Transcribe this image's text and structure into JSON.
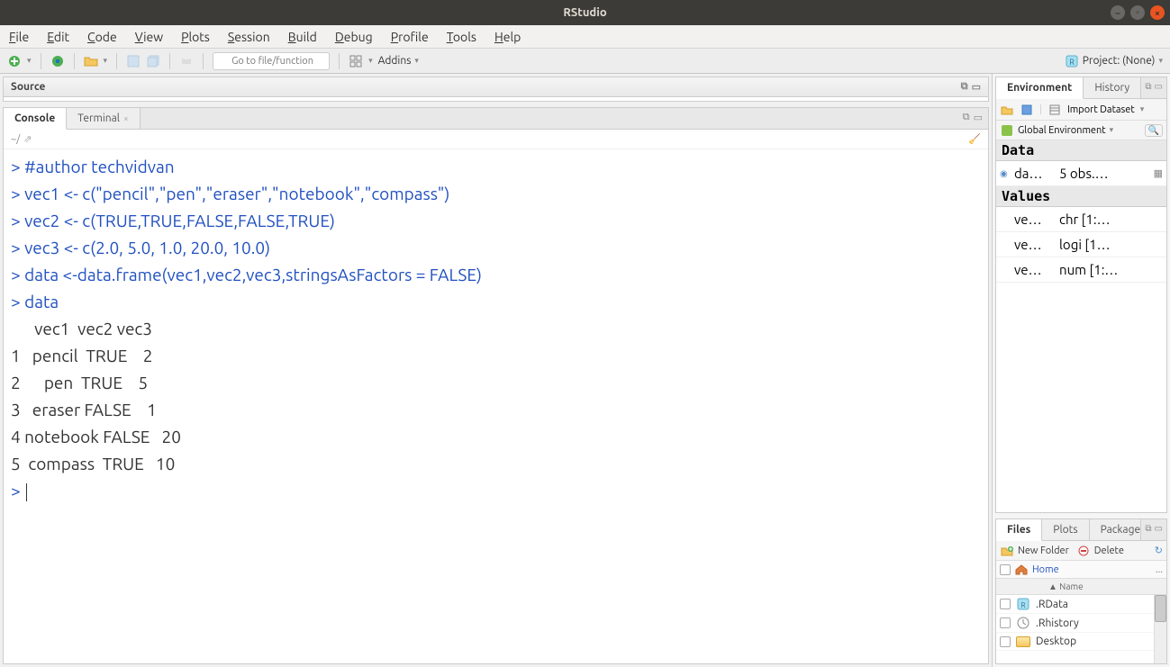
{
  "window": {
    "title": "RStudio"
  },
  "menubar": [
    "File",
    "Edit",
    "Code",
    "View",
    "Plots",
    "Session",
    "Build",
    "Debug",
    "Profile",
    "Tools",
    "Help"
  ],
  "toolbar": {
    "goto_placeholder": "Go to file/function",
    "addins": "Addins",
    "project": "Project: (None)"
  },
  "source": {
    "title": "Source"
  },
  "console": {
    "tabs": [
      {
        "label": "Console",
        "active": true
      },
      {
        "label": "Terminal",
        "active": false,
        "closable": true
      }
    ],
    "path": "~/",
    "prompt": ">",
    "lines": [
      {
        "type": "in",
        "text": "#author techvidvan"
      },
      {
        "type": "in",
        "text": "vec1 <- c(\"pencil\",\"pen\",\"eraser\",\"notebook\",\"compass\")"
      },
      {
        "type": "in",
        "text": "vec2 <- c(TRUE,TRUE,FALSE,FALSE,TRUE)"
      },
      {
        "type": "in",
        "text": "vec3 <- c(2.0, 5.0, 1.0, 20.0, 10.0)"
      },
      {
        "type": "in",
        "text": "data <-data.frame(vec1,vec2,vec3,stringsAsFactors = FALSE)"
      },
      {
        "type": "in",
        "text": "data"
      },
      {
        "type": "out",
        "text": "      vec1  vec2 vec3"
      },
      {
        "type": "out",
        "text": "1   pencil  TRUE    2"
      },
      {
        "type": "out",
        "text": "2      pen  TRUE    5"
      },
      {
        "type": "out",
        "text": "3   eraser FALSE    1"
      },
      {
        "type": "out",
        "text": "4 notebook FALSE   20"
      },
      {
        "type": "out",
        "text": "5  compass  TRUE   10"
      }
    ]
  },
  "env": {
    "tabs": [
      "Environment",
      "History"
    ],
    "import": "Import Dataset",
    "scope": "Global Environment",
    "sections": [
      {
        "title": "Data",
        "rows": [
          {
            "name": "da…",
            "val": "5 obs.…",
            "icon": "table"
          }
        ]
      },
      {
        "title": "Values",
        "rows": [
          {
            "name": "ve…",
            "val": "chr [1:…"
          },
          {
            "name": "ve…",
            "val": "logi [1…"
          },
          {
            "name": "ve…",
            "val": "num [1:…"
          }
        ]
      }
    ]
  },
  "files": {
    "tabs": [
      "Files",
      "Plots",
      "Packages"
    ],
    "new_folder": "New Folder",
    "delete": "Delete",
    "path": "Home",
    "name_header": "▲ Name",
    "rows": [
      {
        "name": ".RData",
        "icon": "rdata"
      },
      {
        "name": ".Rhistory",
        "icon": "rhist"
      },
      {
        "name": "Desktop",
        "icon": "folder"
      }
    ]
  }
}
